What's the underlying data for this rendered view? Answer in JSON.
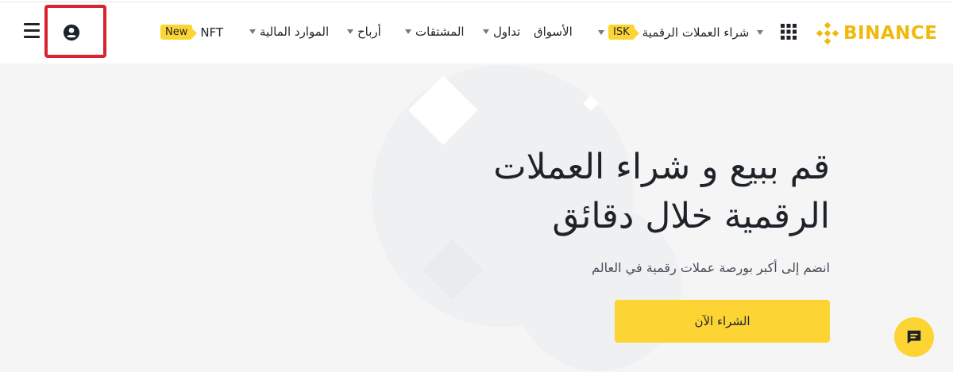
{
  "header": {
    "logo_text": "BINANCE",
    "nav": [
      {
        "label": "شراء العملات الرقمية",
        "tag": "ISK"
      },
      {
        "label": "الأسواق"
      },
      {
        "label": "تداول"
      },
      {
        "label": "المشتقات"
      },
      {
        "label": "أرباح"
      },
      {
        "label": "الموارد المالية"
      },
      {
        "label": "NFT",
        "tag": "New"
      }
    ]
  },
  "hero": {
    "title_line1": "قم ببيع و شراء العملات",
    "title_line2": "الرقمية خلال دقائق",
    "subtitle": "انضم إلى أكبر بورصة عملات رقمية في العالم",
    "button_label": "الشراء الآن"
  },
  "colors": {
    "brand": "#f0b90b",
    "button": "#fcd535",
    "highlight": "#d9232e"
  },
  "icons": [
    "menu-icon",
    "profile-icon",
    "apps-grid-icon",
    "binance-logo-icon",
    "chat-icon"
  ]
}
